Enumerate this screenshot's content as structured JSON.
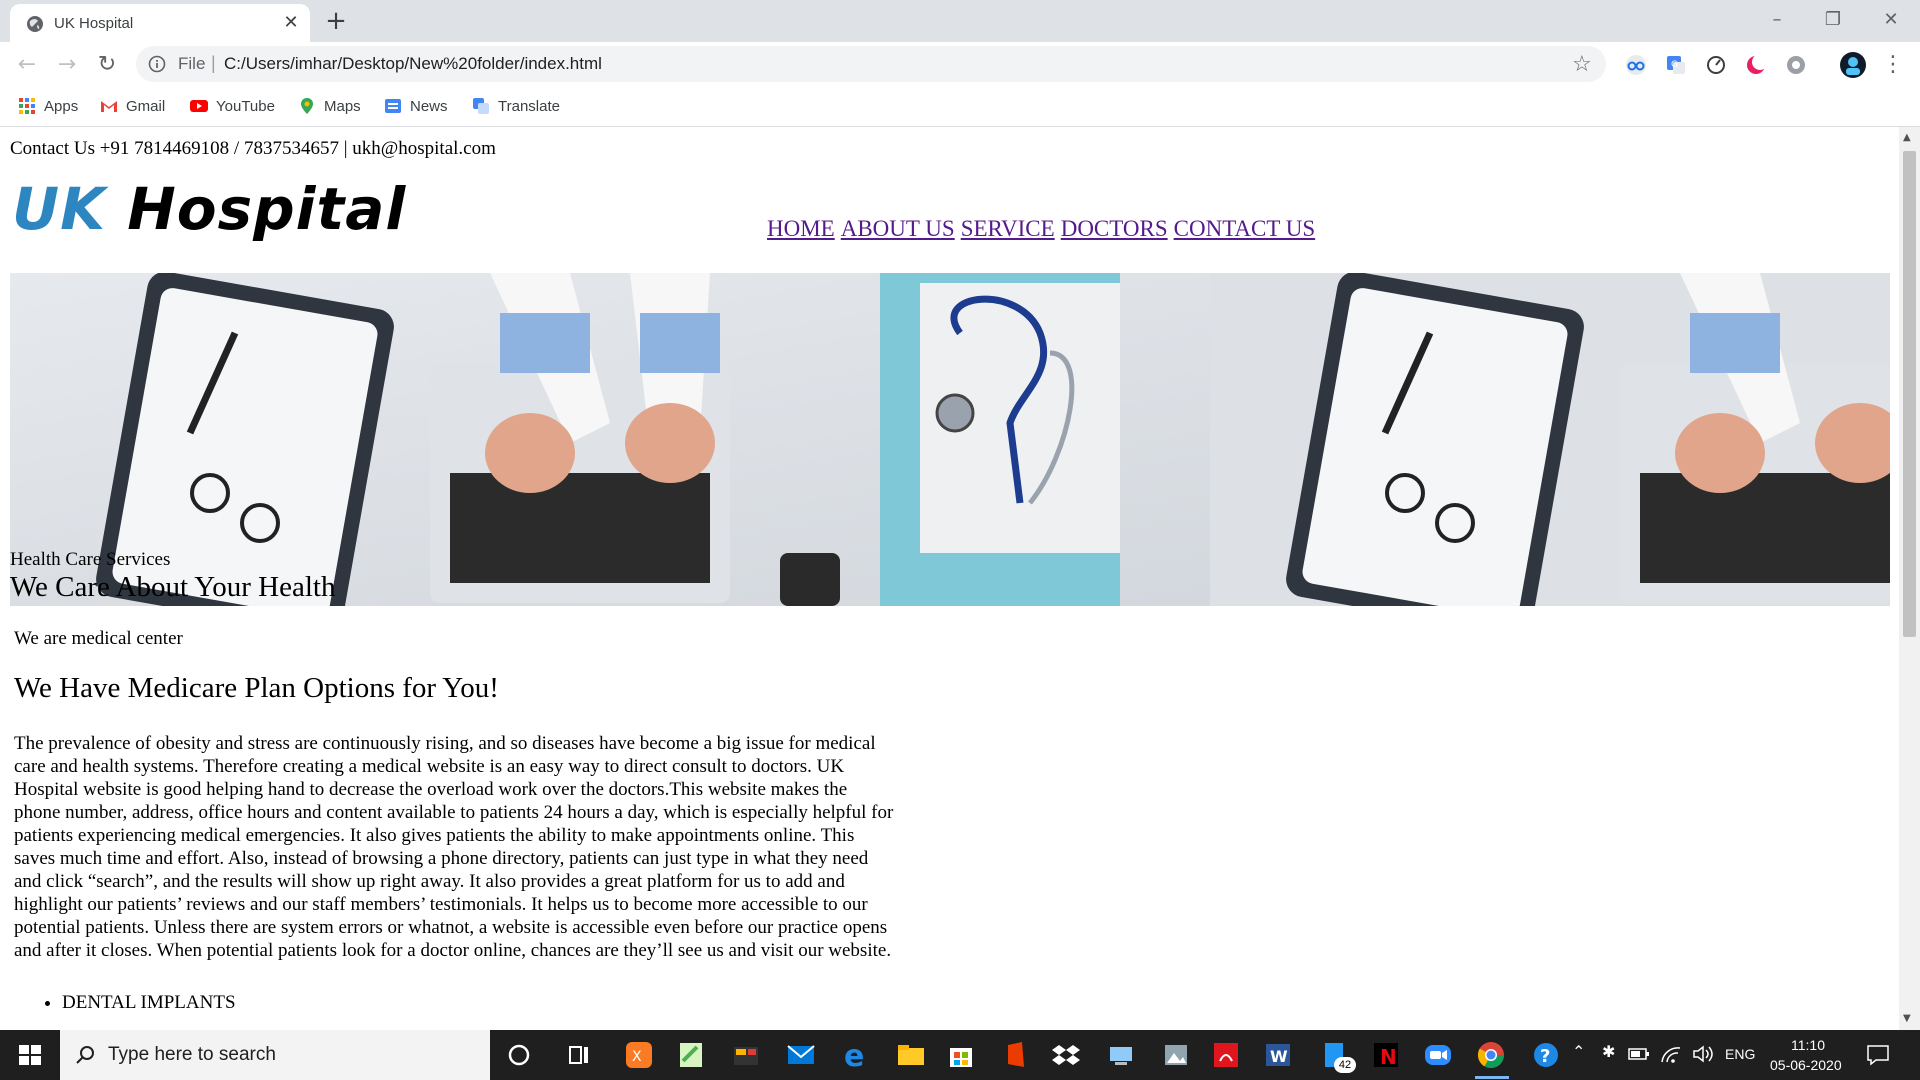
{
  "browser": {
    "tab_title": "UK Hospital",
    "url_scheme": "File",
    "url": "C:/Users/imhar/Desktop/New%20folder/index.html",
    "bookmarks": [
      {
        "label": "Apps",
        "icon": "apps-grid-icon"
      },
      {
        "label": "Gmail",
        "icon": "gmail-icon"
      },
      {
        "label": "YouTube",
        "icon": "youtube-icon"
      },
      {
        "label": "Maps",
        "icon": "maps-pin-icon"
      },
      {
        "label": "News",
        "icon": "news-icon"
      },
      {
        "label": "Translate",
        "icon": "translate-icon"
      }
    ]
  },
  "site": {
    "contact_line": "Contact Us +91 7814469108 / 7837534657 | ukh@hospital.com",
    "logo_part1": "UK",
    "logo_part2": "Hospital",
    "nav": [
      "HOME",
      "ABOUT US",
      "SERVICE",
      "DOCTORS",
      "CONTACT US"
    ],
    "hero_subtitle": "Health Care Services",
    "hero_title": "We Care About Your Health",
    "intro": "We are medical center",
    "heading": "We Have Medicare Plan Options for You!",
    "paragraph": "The prevalence of obesity and stress are continuously rising, and so diseases have become a big issue for medical care and health systems. Therefore creating a medical website is an easy way to direct consult to doctors. UK Hospital website is good helping hand to decrease the overload work over the doctors.This website makes the phone number, address, office hours and content available to patients 24 hours a day, which is especially helpful for patients experiencing medical emergencies. It also gives patients the ability to make appointments online. This saves much time and effort. Also, instead of browsing a phone directory, patients can just type in what they need and click “search”, and the results will show up right away. It also provides a great platform for us to add and highlight our patients’ reviews and our staff members’ testimonials. It helps us to become more accessible to our potential patients. Unless there are system errors or whatnot, a website is accessible even before our practice opens and after it closes. When potential patients look for a doctor online, chances are they’ll see us and visit our website.",
    "list_items": [
      "DENTAL IMPLANTS"
    ]
  },
  "taskbar": {
    "search_placeholder": "Type here to search",
    "language": "ENG",
    "time": "11:10",
    "date": "05-06-2020",
    "badge_count": "42"
  },
  "colors": {
    "logo_blue": "#2e86c1",
    "link_visited": "#551a8b",
    "taskbar_bg": "#1f1f1f"
  }
}
